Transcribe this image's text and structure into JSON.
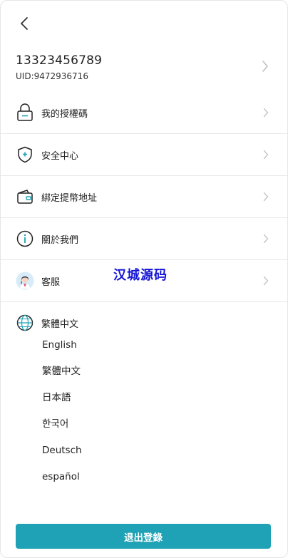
{
  "account": {
    "phone": "13323456789",
    "uid": "UID:9472936716"
  },
  "menu": {
    "items": [
      {
        "label": "我的授權碼",
        "icon": "lock-icon"
      },
      {
        "label": "安全中心",
        "icon": "shield-icon"
      },
      {
        "label": "綁定提幣地址",
        "icon": "wallet-icon"
      },
      {
        "label": "關於我們",
        "icon": "info-icon"
      },
      {
        "label": "客服",
        "icon": "customer-service-avatar-icon"
      }
    ]
  },
  "language": {
    "current": "繁體中文",
    "icon": "globe-icon",
    "options": [
      "English",
      "繁體中文",
      "日本語",
      "한국어",
      "Deutsch",
      "español"
    ]
  },
  "watermark": "汉城源码",
  "logout_label": "退出登錄",
  "colors": {
    "accent": "#1fa2b5",
    "watermark": "#1414d6",
    "divider": "#e8e8e8",
    "chevron": "#bbbbbb"
  }
}
